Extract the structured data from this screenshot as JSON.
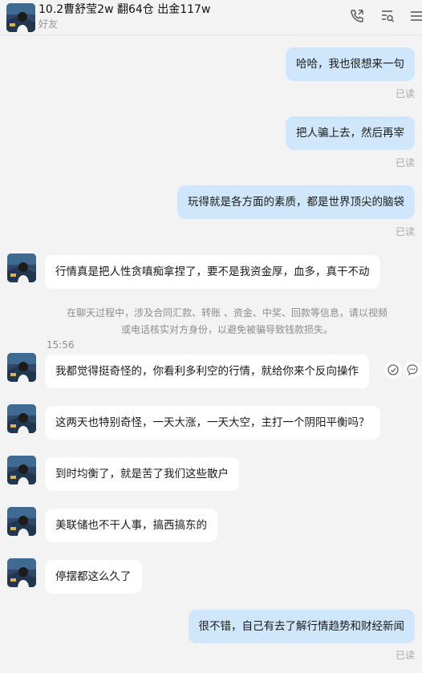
{
  "header": {
    "title": "10.2曹舒莹2w 翻64仓 出金117w",
    "subtitle": "好友",
    "icons": [
      "phone-icon",
      "search-list-icon",
      "menu-icon"
    ]
  },
  "messages": [
    {
      "side": "right",
      "text": "哈哈，我也很想来一句",
      "status": "已读"
    },
    {
      "side": "right",
      "text": "把人骗上去，然后再宰",
      "status": "已读"
    },
    {
      "side": "right",
      "text": "玩得就是各方面的素质，都是世界顶尖的脑袋",
      "status": "已读"
    },
    {
      "side": "left",
      "text": "行情真是把人性贪嗔痴拿捏了，要不是我资金厚，血多，真干不动"
    },
    {
      "side": "left",
      "text": "我都觉得挺奇怪的，你看利多利空的行情，就给你来个反向操作"
    },
    {
      "side": "left",
      "text": "这两天也特别奇怪，一天大涨，一天大空，主打一个阴阳平衡吗？"
    },
    {
      "side": "left",
      "text": "到时均衡了，就是苦了我们这些散户"
    },
    {
      "side": "left",
      "text": "美联储也不干人事，搞西搞东的"
    },
    {
      "side": "left",
      "text": "停摆都这么久了"
    },
    {
      "side": "right",
      "text": "很不错，自己有去了解行情趋势和财经新闻",
      "status": "已读"
    }
  ],
  "notice": "在聊天过程中，涉及合同汇款、转账 、资金、中奖、回款等信息，请以视频或电话核实对方身份，以避免被骗导致钱款损失。",
  "timestamp": "15:56",
  "colors": {
    "background": "#f3f3f3",
    "bubble_self": "#cfe6fb",
    "bubble_other": "#ffffff",
    "muted_text": "#8c8c8c"
  }
}
